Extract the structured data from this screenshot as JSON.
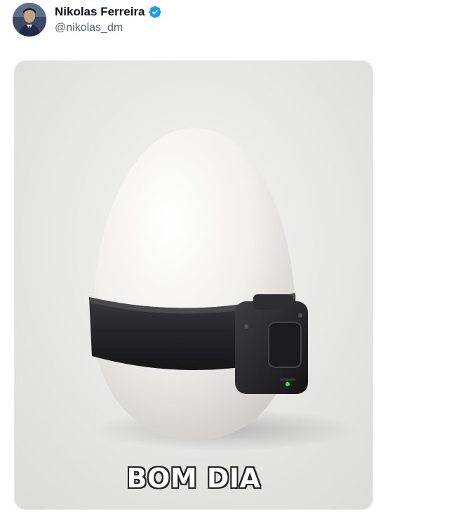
{
  "author": {
    "display_name": "Nikolas Ferreira",
    "handle": "@nikolas_dm",
    "verified": true,
    "avatar_icon": "profile-photo"
  },
  "media": {
    "caption": "BOM DIA",
    "subject_icon": "egg-with-ankle-monitor"
  },
  "colors": {
    "verified_badge": "#1d9bf0",
    "name_text": "#0f1419",
    "handle_text": "#536471",
    "monitor_led": "#2fe36a"
  }
}
